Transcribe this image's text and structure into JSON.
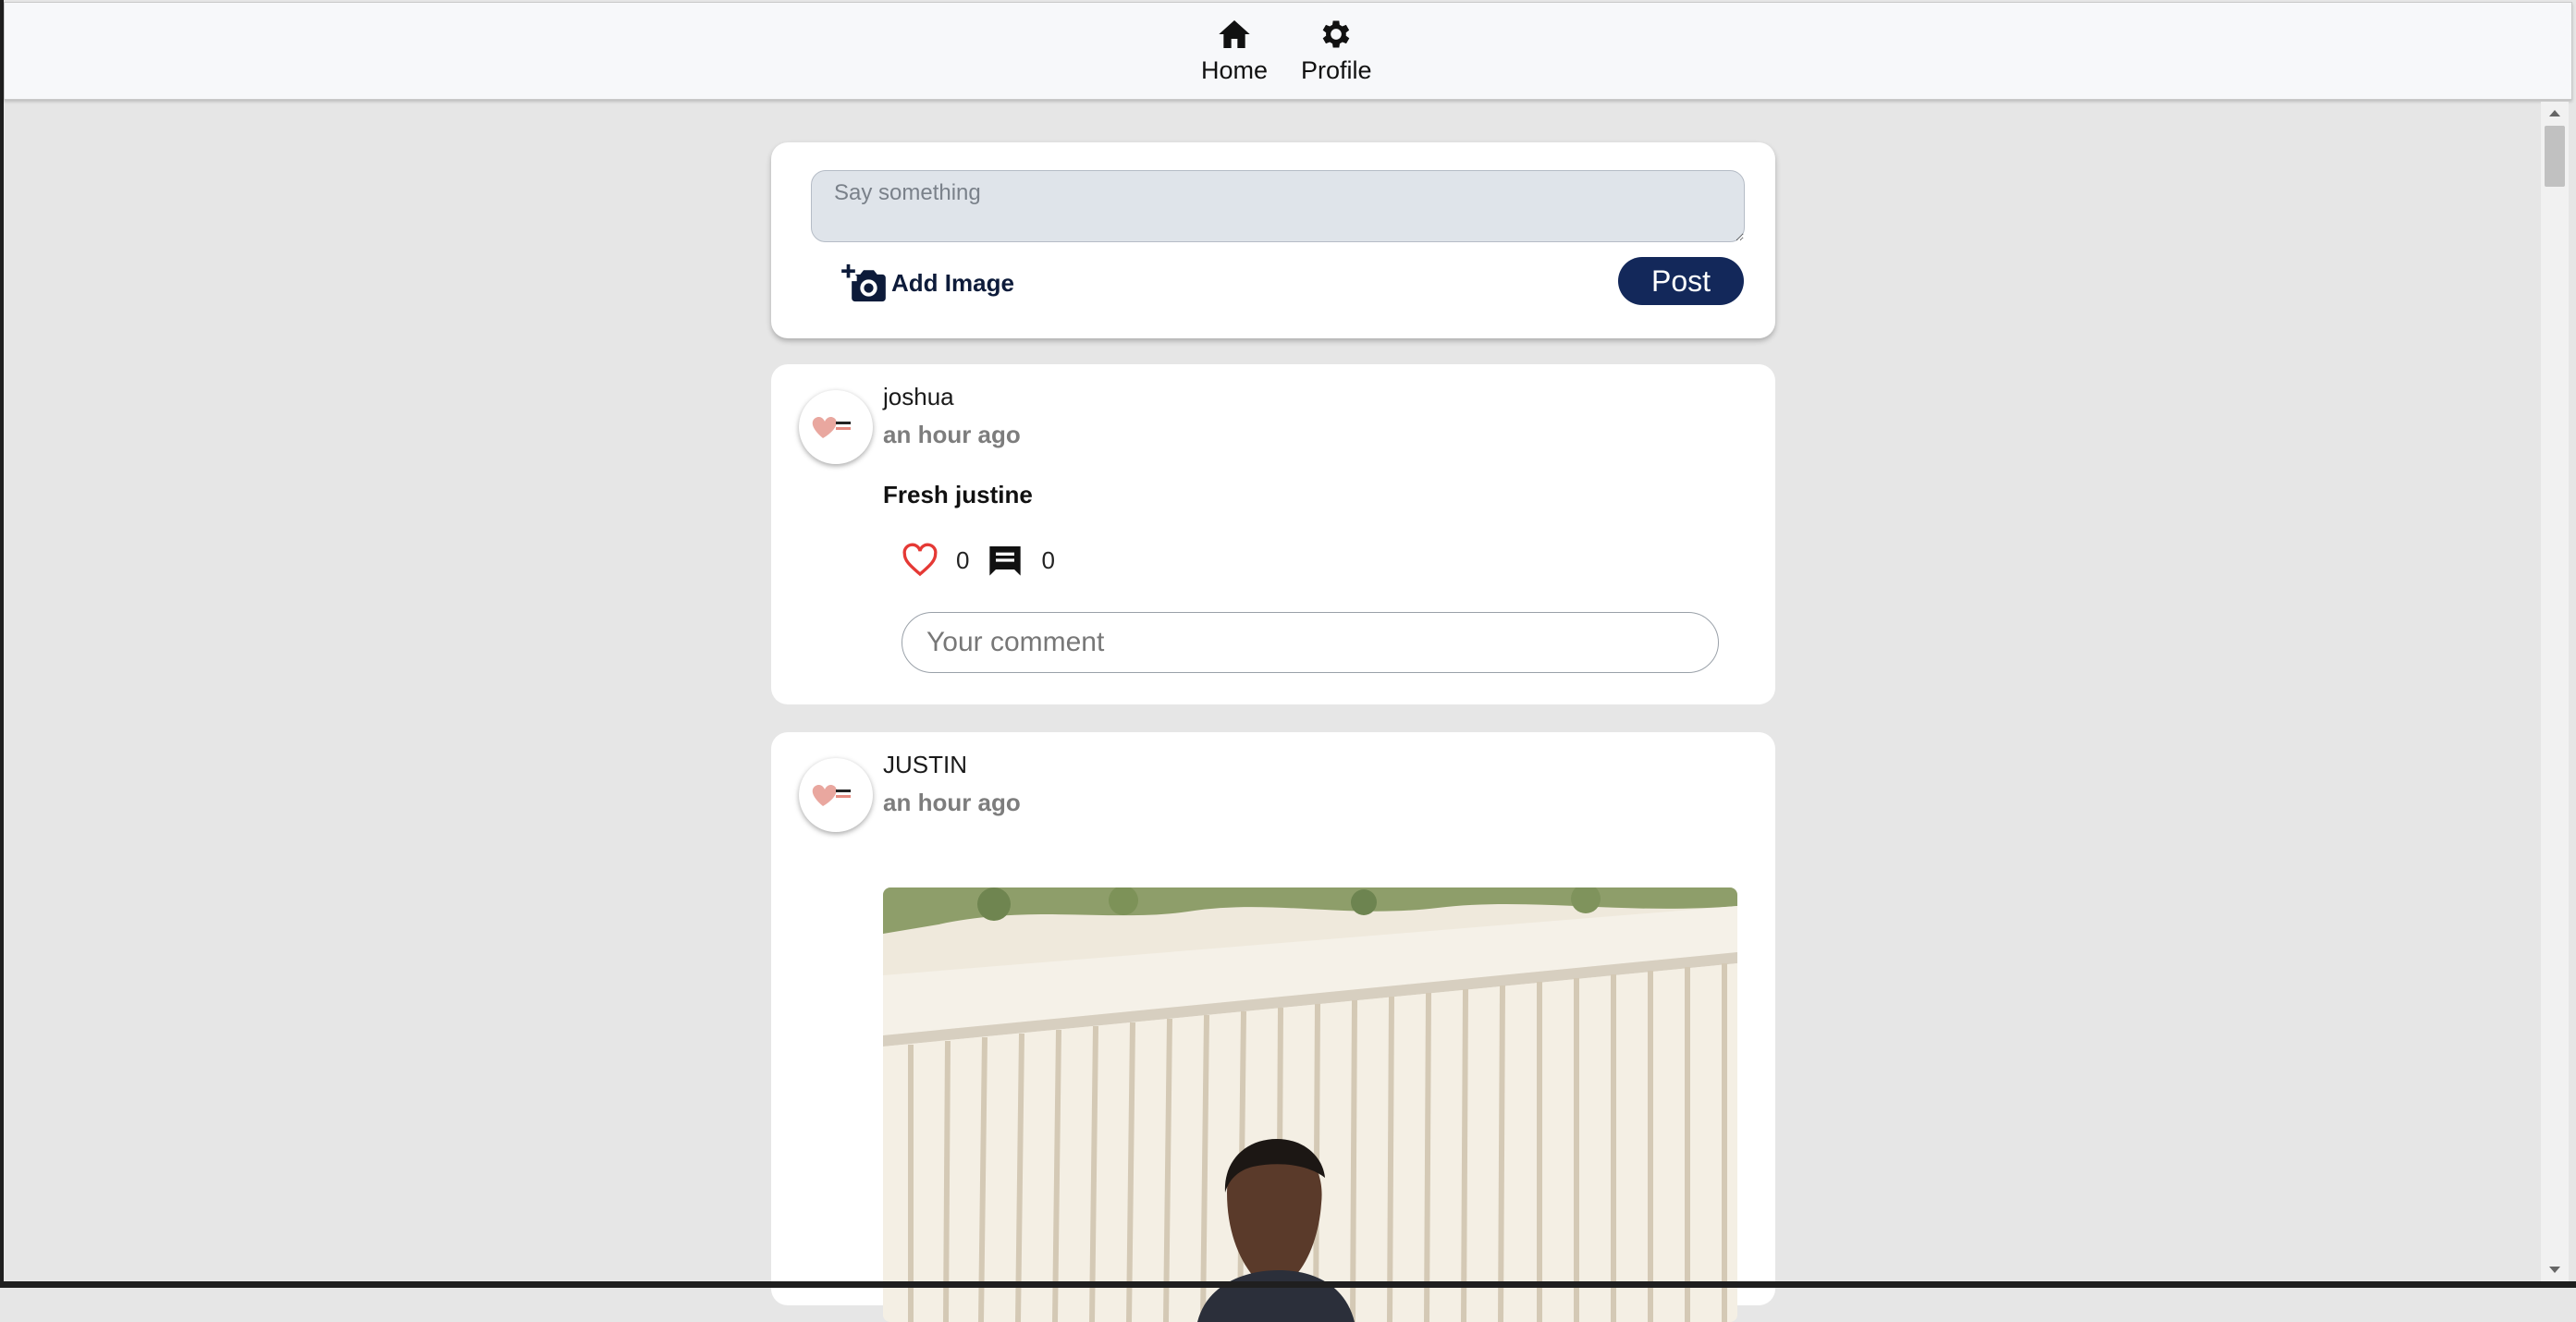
{
  "nav": {
    "items": [
      {
        "label": "Home",
        "icon": "home-icon"
      },
      {
        "label": "Profile",
        "icon": "gear-icon"
      }
    ]
  },
  "composer": {
    "placeholder": "Say something",
    "add_image_label": "Add Image",
    "post_label": "Post"
  },
  "posts": [
    {
      "username": "joshua",
      "time": "an hour ago",
      "text": "Fresh justine",
      "likes": "0",
      "comments": "0",
      "comment_placeholder": "Your comment"
    },
    {
      "username": "JUSTIN",
      "time": "an hour ago",
      "has_image": true
    }
  ],
  "colors": {
    "accent": "#13285a",
    "heart": "#e53935",
    "background": "#e6e6e6"
  }
}
